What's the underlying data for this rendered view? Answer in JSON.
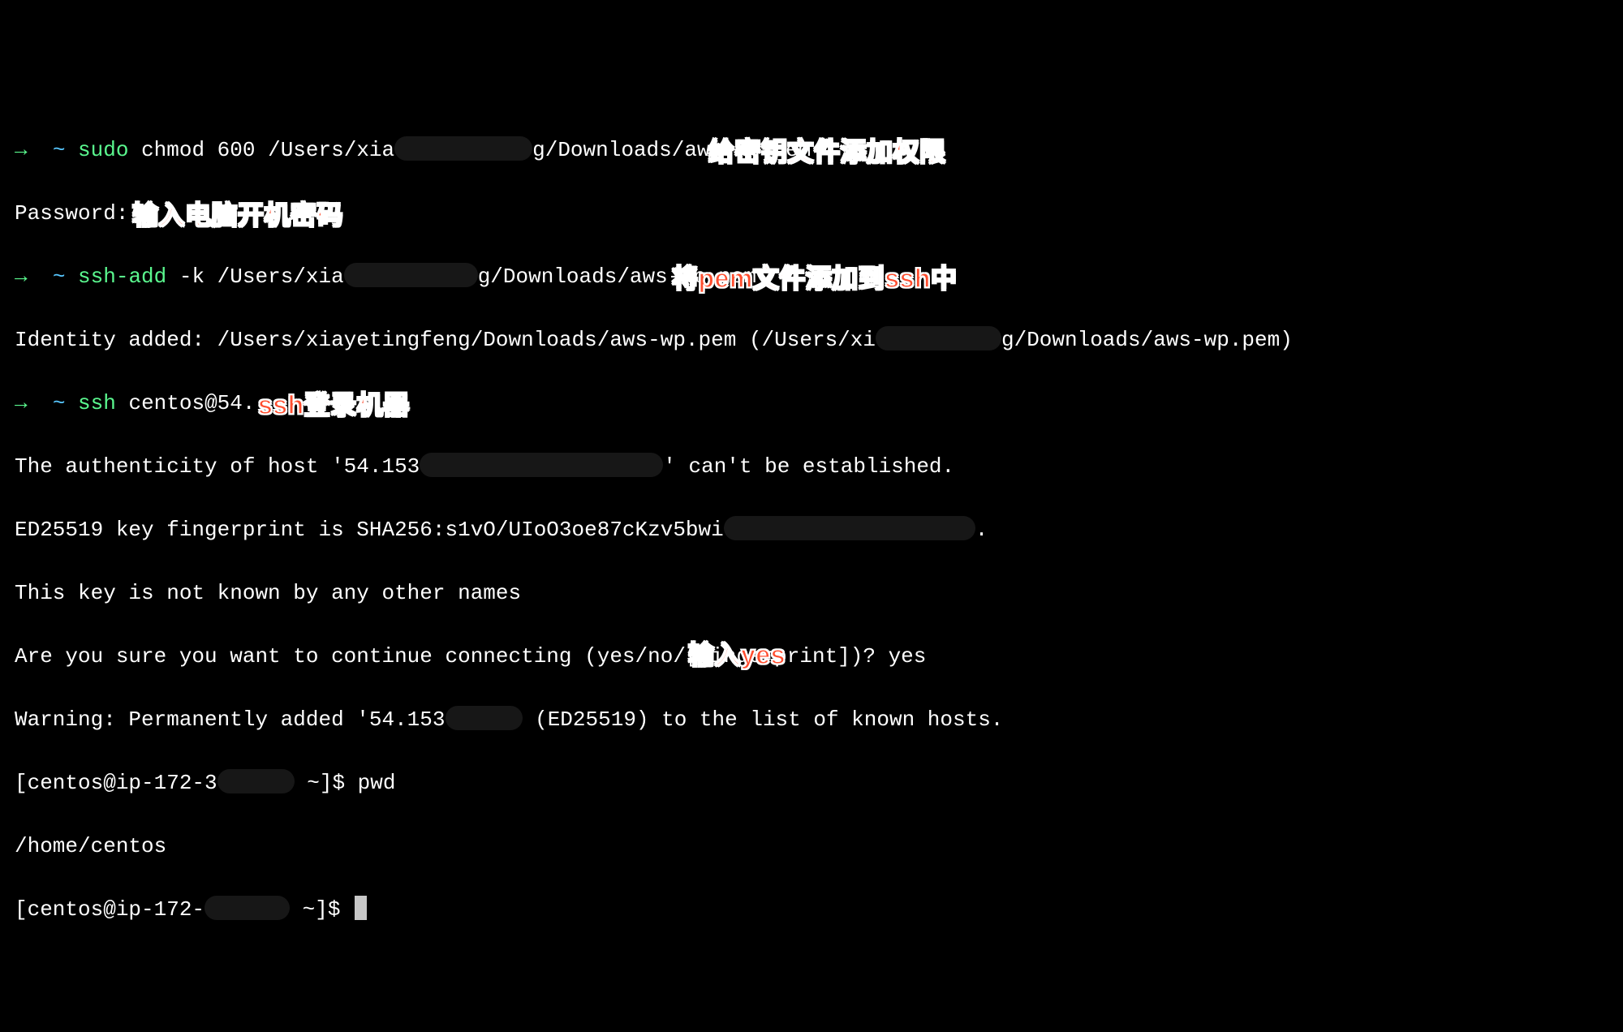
{
  "prompt": {
    "arrow": "→",
    "tilde": "~"
  },
  "lines": {
    "l1": {
      "cmd_part1": "sudo",
      "cmd_part2": " chmod 600 /Users/xia",
      "cmd_part3": "g/Downloads/aws-wp.pem",
      "annotation": "给密钥文件添加权限"
    },
    "l2": {
      "text": "Password:",
      "annotation": "输入电脑开机密码"
    },
    "l3": {
      "cmd_part1": "ssh-add",
      "cmd_part2": " -k /Users/xia",
      "cmd_part3": "g/Downloads/aws-wp.pem",
      "annotation": "将pem文件添加到ssh中"
    },
    "l4": {
      "part1": "Identity added: /Users/xiayetingfeng/Downloads/aws-wp.pem (/Users/xi",
      "part2": "g/Downloads/aws-wp.pem)"
    },
    "l5": {
      "cmd_part1": "ssh",
      "cmd_part2": " centos@54.153.",
      "annotation": "ssh登录机器"
    },
    "l6": {
      "part1": "The authenticity of host '54.153",
      "part2": "' can't be established."
    },
    "l7": {
      "part1": "ED25519 key fingerprint is SHA256:s1vO/UIoO3oe87cKzv5bwi",
      "part2": "."
    },
    "l8": {
      "text": "This key is not known by any other names"
    },
    "l9": {
      "text": "Are you sure you want to continue connecting (yes/no/[fingerprint])? yes",
      "annotation": "输入yes"
    },
    "l10": {
      "part1": "Warning: Permanently added '54.153",
      "part2": " (ED25519) to the list of known hosts."
    },
    "l11": {
      "part1": "[centos@ip-172-3",
      "part2": " ~]$ pwd"
    },
    "l12": {
      "text": "/home/centos"
    },
    "l13": {
      "part1": "[centos@ip-172-",
      "part2": " ~]$ "
    }
  }
}
